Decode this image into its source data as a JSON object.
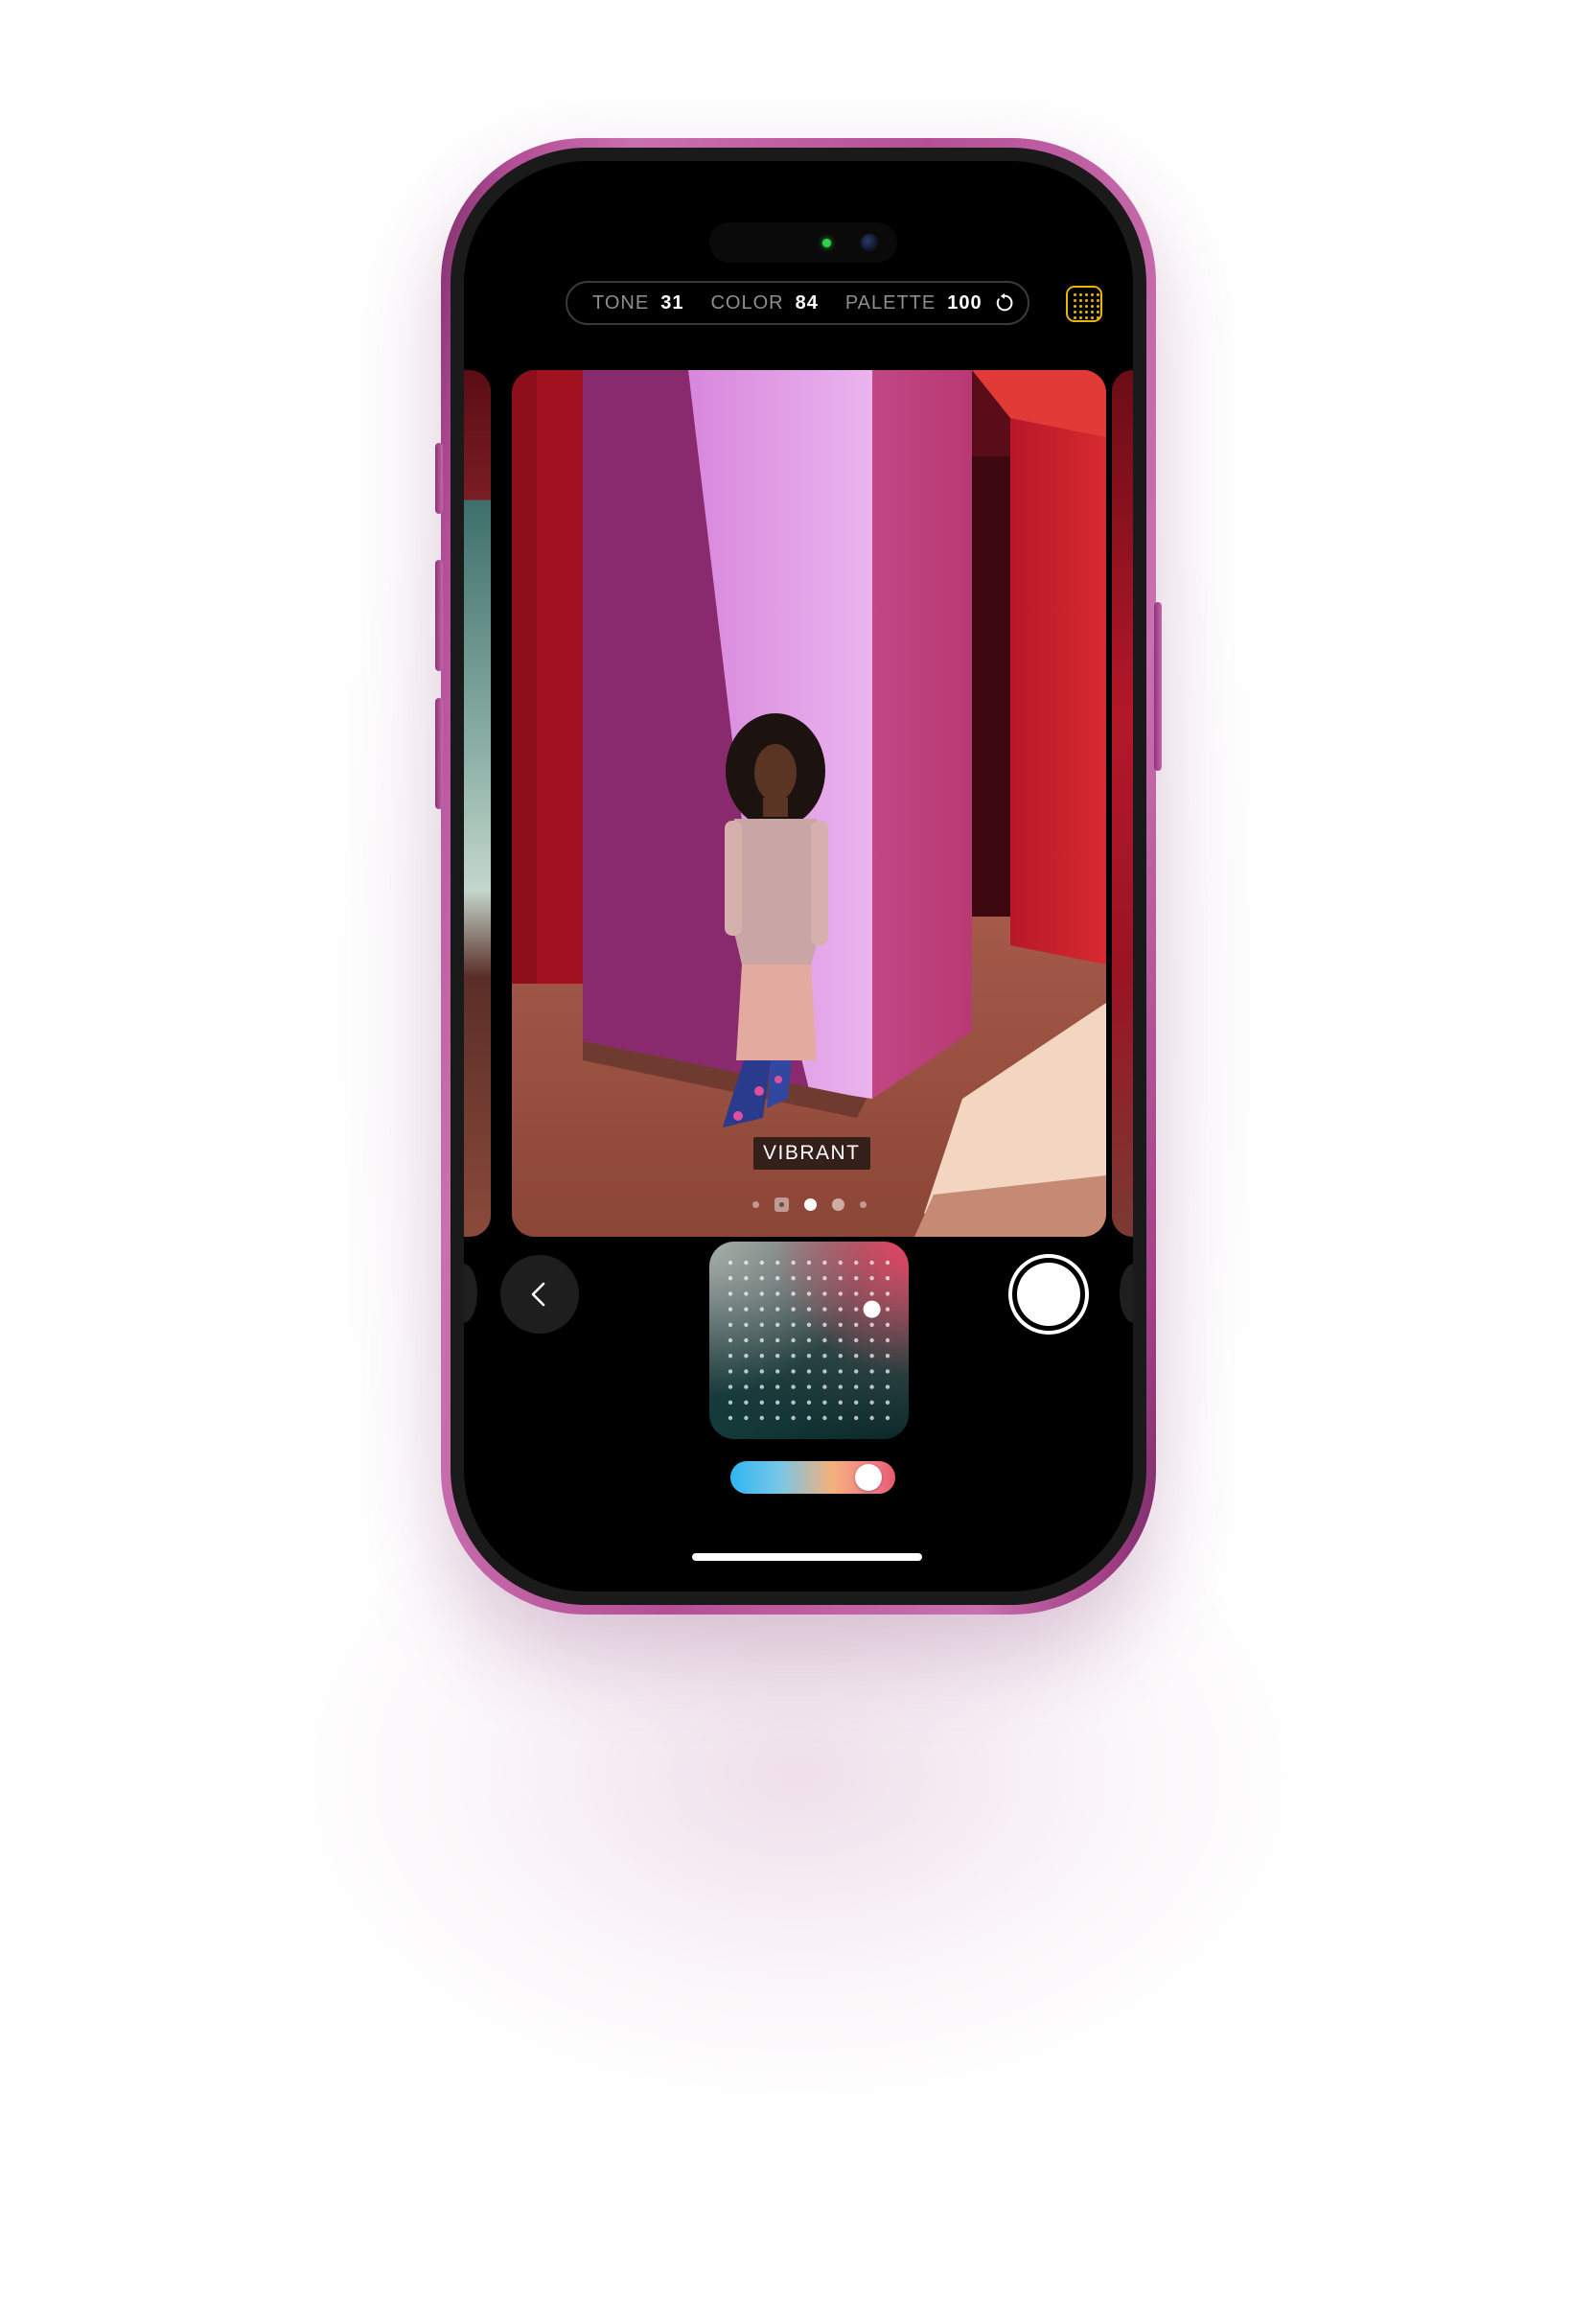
{
  "styles_bar": {
    "tone_label": "TONE",
    "tone_value": "31",
    "color_label": "COLOR",
    "color_value": "84",
    "palette_label": "PALETTE",
    "palette_value": "100",
    "reset_icon": "reset-icon",
    "grid_icon": "grid-icon"
  },
  "photo": {
    "style_name": "VIBRANT",
    "pages": 5,
    "active_page": 3
  },
  "controls": {
    "back_icon": "chevron-left-icon",
    "shutter_icon": "shutter-button",
    "pad": {
      "columns": 11,
      "rows": 11,
      "selected_col": 9,
      "selected_row": 3
    },
    "palette_slider_level": 0.92
  },
  "colors": {
    "frame": "#b44f97",
    "accent_yellow": "#e6b800",
    "pad_red": "#ec4060",
    "pad_teal": "#143c3c"
  }
}
